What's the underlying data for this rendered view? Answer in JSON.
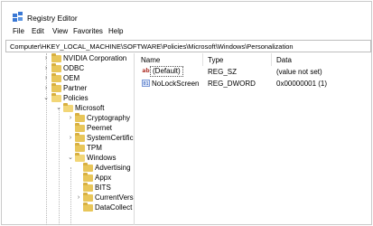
{
  "window": {
    "title": "Registry Editor",
    "icon": "registry-editor-icon"
  },
  "menu": [
    "File",
    "Edit",
    "View",
    "Favorites",
    "Help"
  ],
  "address": "Computer\\HKEY_LOCAL_MACHINE\\SOFTWARE\\Policies\\Microsoft\\Windows\\Personalization",
  "tree": {
    "items": [
      {
        "label": "NVIDIA Corporation",
        "chevron": ">"
      },
      {
        "label": "ODBC",
        "chevron": ">"
      },
      {
        "label": "OEM",
        "chevron": ">"
      },
      {
        "label": "Partner",
        "chevron": ">"
      },
      {
        "label": "Policies",
        "chevron": "v"
      },
      {
        "label": "Microsoft",
        "chevron": "v"
      },
      {
        "label": "Cryptography",
        "chevron": ">"
      },
      {
        "label": "Peernet",
        "chevron": ""
      },
      {
        "label": "SystemCertific",
        "chevron": ">"
      },
      {
        "label": "TPM",
        "chevron": ""
      },
      {
        "label": "Windows",
        "chevron": "v"
      },
      {
        "label": "Advertising",
        "chevron": ""
      },
      {
        "label": "Appx",
        "chevron": ""
      },
      {
        "label": "BITS",
        "chevron": ""
      },
      {
        "label": "CurrentVers",
        "chevron": ">"
      },
      {
        "label": "DataCollect",
        "chevron": ""
      }
    ]
  },
  "values": {
    "headers": {
      "name": "Name",
      "type": "Type",
      "data": "Data"
    },
    "rows": [
      {
        "name": "(Default)",
        "type": "REG_SZ",
        "data": "(value not set)",
        "icon": "string-value-icon"
      },
      {
        "name": "NoLockScreen",
        "type": "REG_DWORD",
        "data": "0x00000001 (1)",
        "icon": "binary-value-icon"
      }
    ]
  },
  "colors": {
    "folder": "#e8c65a",
    "string_icon": "#b0362e",
    "binary_icon": "#1f4fb5"
  }
}
